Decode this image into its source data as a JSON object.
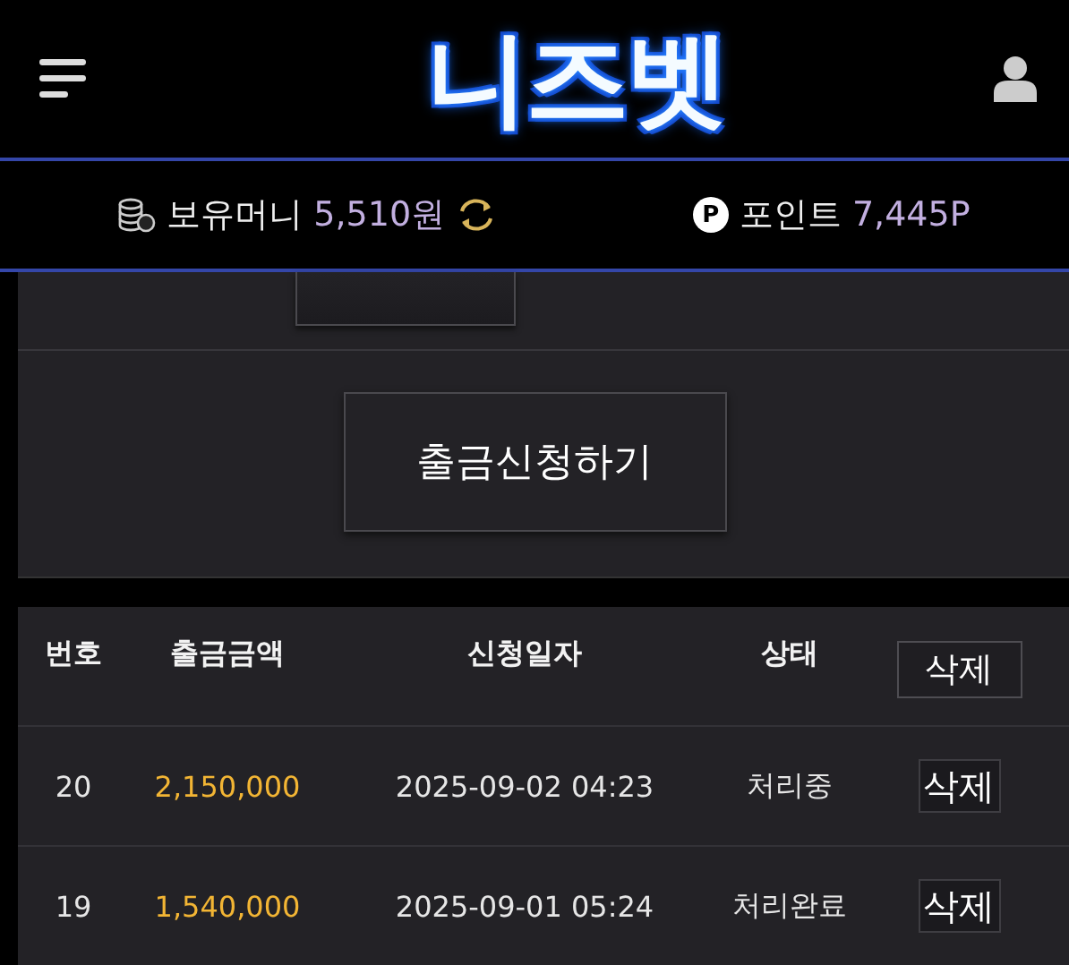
{
  "header": {
    "logo": "니즈벳"
  },
  "balance_bar": {
    "money_label": "보유머니",
    "money_value": "5,510원",
    "points_icon": "P",
    "points_label": "포인트",
    "points_value": "7,445P"
  },
  "withdraw_panel": {
    "button": "출금신청하기"
  },
  "table": {
    "columns": [
      {
        "label": "번호",
        "kind": "text"
      },
      {
        "label": "출금금액",
        "kind": "text"
      },
      {
        "label": "신청일자",
        "kind": "text"
      },
      {
        "label": "상태",
        "kind": "text"
      },
      {
        "label": "삭제",
        "kind": "button"
      }
    ],
    "rows": [
      {
        "number": "20",
        "amount": "2,150,000",
        "date": "2025-09-02 04:23",
        "status": "처리중",
        "delete": "삭제"
      },
      {
        "number": "19",
        "amount": "1,540,000",
        "date": "2025-09-01 05:24",
        "status": "처리완료",
        "delete": "삭제"
      }
    ]
  }
}
